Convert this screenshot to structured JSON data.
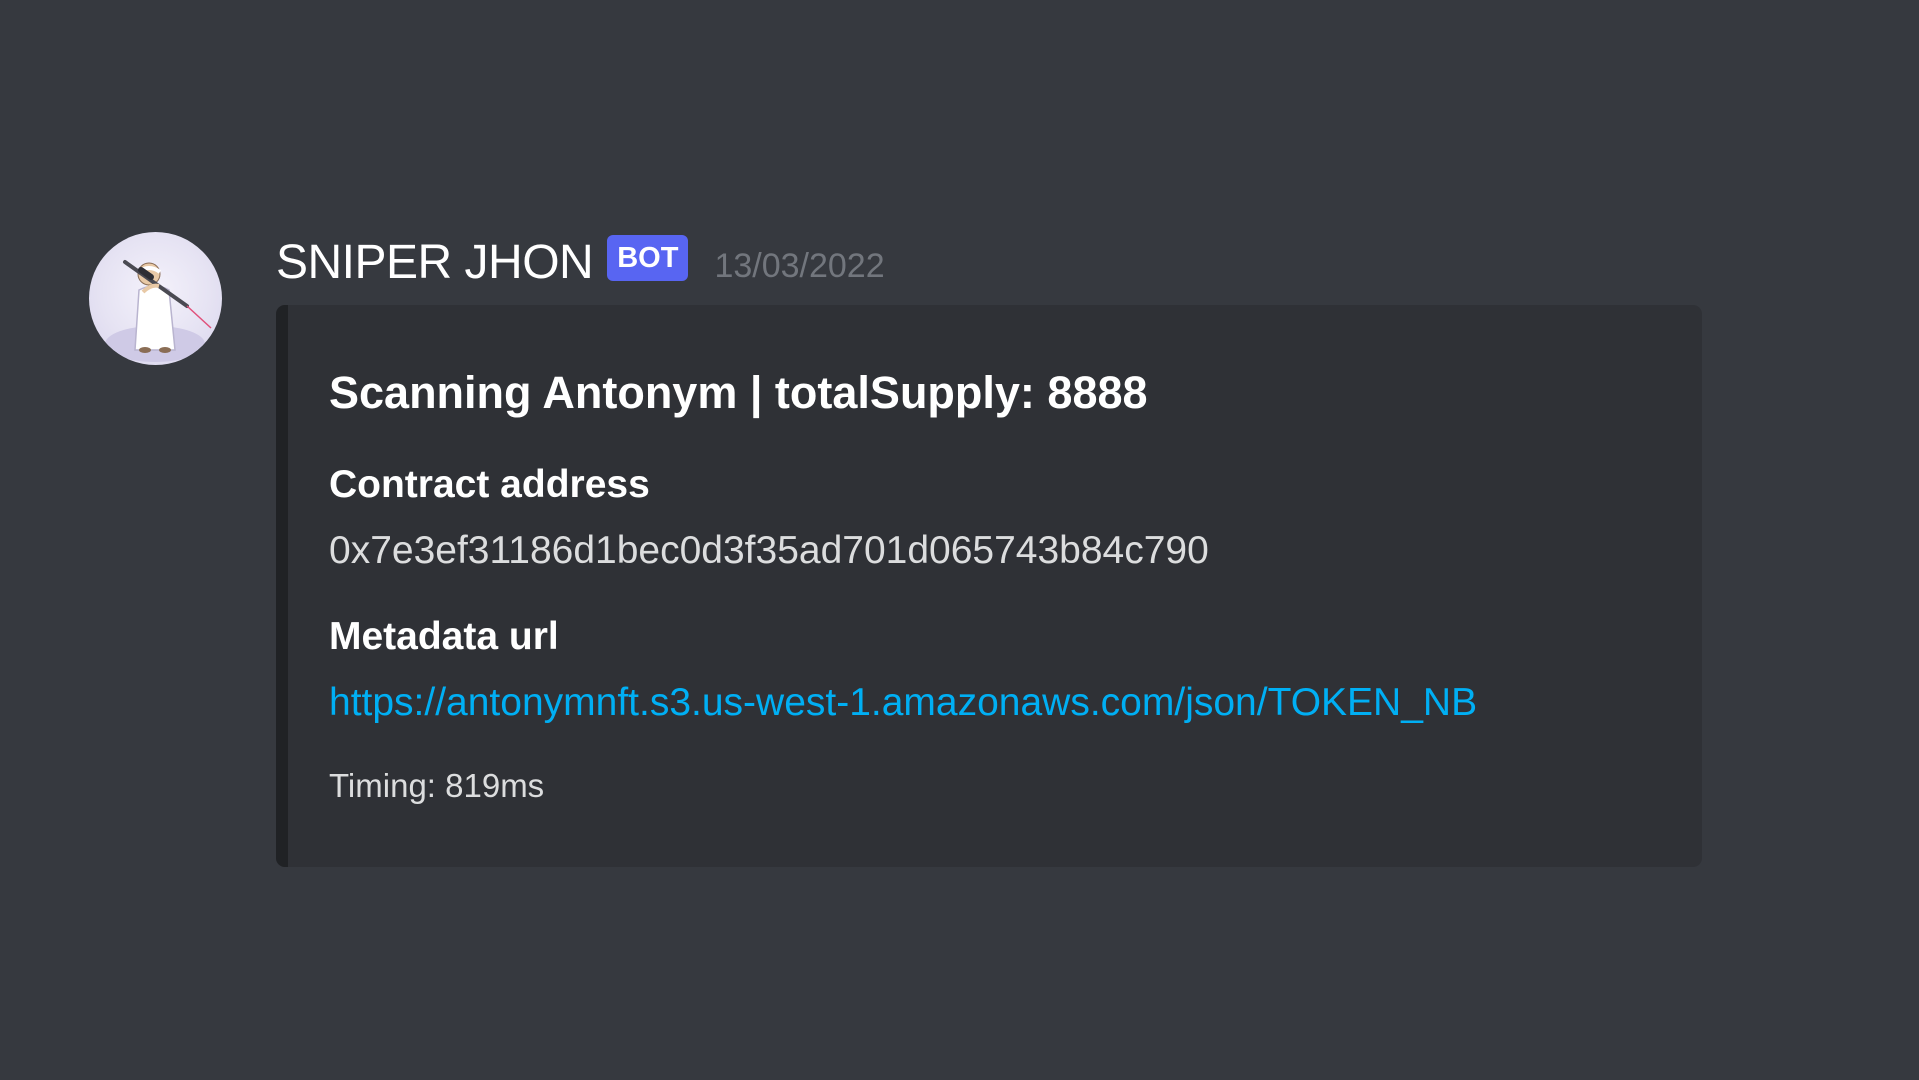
{
  "message": {
    "author": {
      "name": "SNIPER JHON",
      "tag": "BOT"
    },
    "timestamp": "13/03/2022",
    "embed": {
      "title": "Scanning Antonym | totalSupply: 8888",
      "fields": [
        {
          "name": "Contract address",
          "value": "0x7e3ef31186d1bec0d3f35ad701d065743b84c790"
        },
        {
          "name": "Metadata url",
          "value": "https://antonymnft.s3.us-west-1.amazonaws.com/json/TOKEN_NB"
        }
      ],
      "footer": "Timing: 819ms"
    }
  },
  "colors": {
    "background": "#36393f",
    "embed_background": "#2f3136",
    "embed_bar": "#202225",
    "bot_tag": "#5865f2",
    "link": "#00aff4",
    "timestamp": "#72767d"
  }
}
